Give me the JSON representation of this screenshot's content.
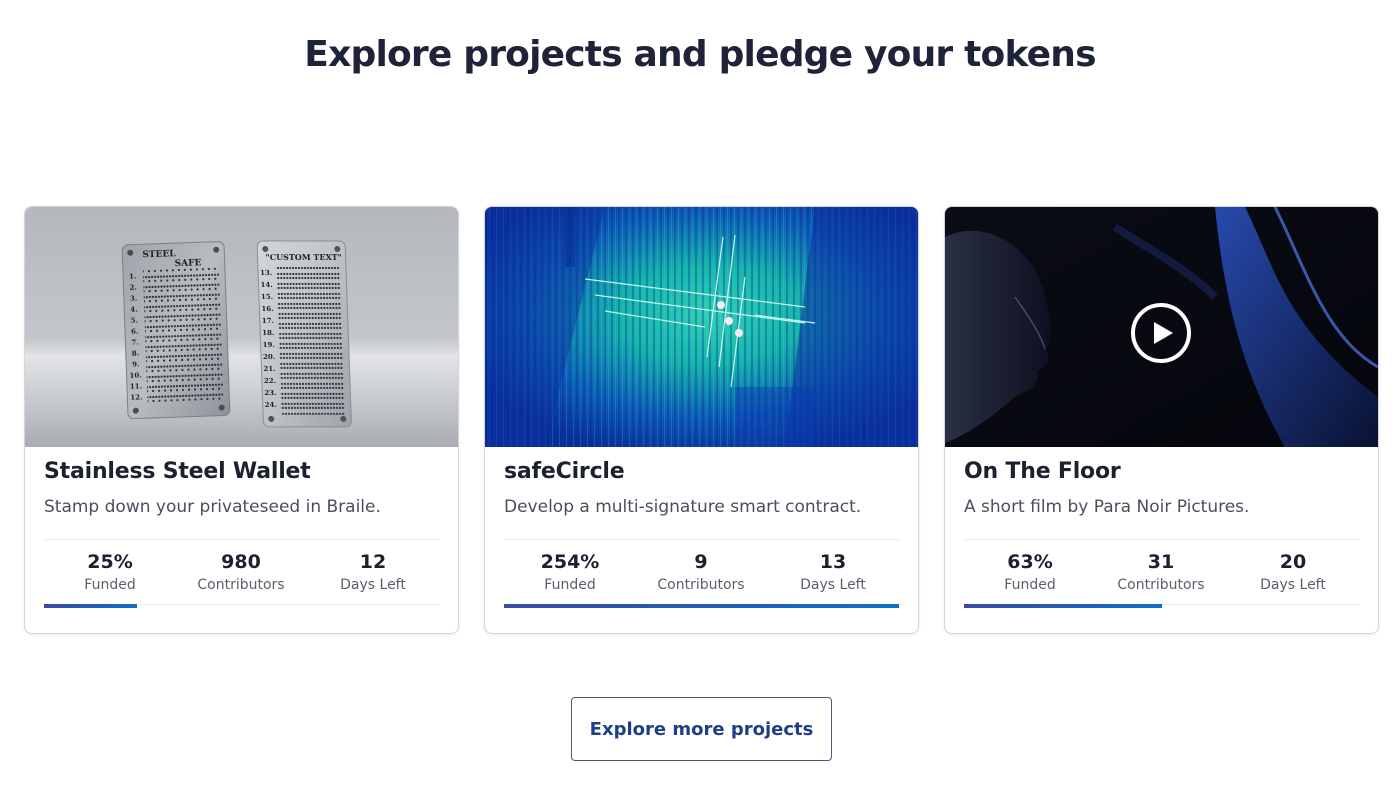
{
  "page": {
    "title": "Explore projects and pledge your tokens"
  },
  "projects": [
    {
      "title": "Stainless Steel Wallet",
      "description": "Stamp down your privateseed in Braile.",
      "stats": {
        "funded": "25%",
        "funded_label": "Funded",
        "contributors": "980",
        "contributors_label": "Contributors",
        "days_left": "12",
        "days_left_label": "Days Left"
      },
      "progress_fraction": 0.235,
      "image_subject": "steel-plates-image",
      "plate_text": {
        "left_header_1": "STEEL",
        "left_header_2": "SAFE",
        "right_header": "\"CUSTOM TEXT\""
      }
    },
    {
      "title": "safeCircle",
      "description": "Develop a multi-signature smart contract.",
      "stats": {
        "funded": "254%",
        "funded_label": "Funded",
        "contributors": "9",
        "contributors_label": "Contributors",
        "days_left": "13",
        "days_left_label": "Days Left"
      },
      "progress_fraction": 1.0,
      "image_subject": "abstract-circuit-image"
    },
    {
      "title": "On The Floor",
      "description": "A short film by Para Noir Pictures.",
      "stats": {
        "funded": "63%",
        "funded_label": "Funded",
        "contributors": "31",
        "contributors_label": "Contributors",
        "days_left": "20",
        "days_left_label": "Days Left"
      },
      "progress_fraction": 0.5,
      "image_subject": "film-still-image",
      "media_icon": "play-icon"
    }
  ],
  "explore_button": {
    "label": "Explore more projects"
  },
  "colors": {
    "title": "#1d2338",
    "button_text": "#1d3f86",
    "progress_start": "#3c4aa3",
    "progress_end": "#0c72c8"
  }
}
